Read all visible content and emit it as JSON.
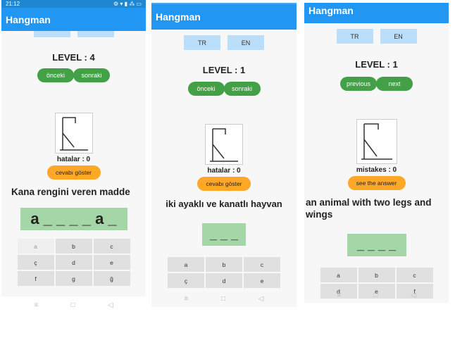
{
  "status_bar": {
    "time": "21:12",
    "icons": "⚙ ▾ ▮ ⁂ ▭"
  },
  "screens": [
    {
      "app_title": "Hangman",
      "level": "LEVEL : 4",
      "prev_label": "önceki",
      "next_label": "sonraki",
      "mistakes": "hatalar : 0",
      "answer_label": "cevabı göster",
      "hint": "Kana rengini veren madde",
      "word": "a _ _ _ _ a _",
      "keys": [
        "a",
        "b",
        "c",
        "ç",
        "d",
        "e",
        "f",
        "g",
        "ğ"
      ]
    },
    {
      "app_title": "Hangman",
      "lang_tr": "TR",
      "lang_en": "EN",
      "level": "LEVEL : 1",
      "prev_label": "önceki",
      "next_label": "sonraki",
      "mistakes": "hatalar : 0",
      "answer_label": "cevabı göster",
      "hint": "iki ayaklı ve kanatlı hayvan",
      "word": "_ _ _",
      "keys": [
        "a",
        "b",
        "c",
        "ç",
        "d",
        "e"
      ]
    },
    {
      "app_title": "Hangman",
      "lang_tr": "TR",
      "lang_en": "EN",
      "level": "LEVEL : 1",
      "prev_label": "previous",
      "next_label": "next",
      "mistakes": "mistakes : 0",
      "answer_label": "see the answer",
      "hint": "an animal with two legs and wings",
      "word": "_ _ _ _",
      "keys": [
        "a",
        "b",
        "c",
        "d",
        "e",
        "f"
      ]
    }
  ],
  "navbar_icons": {
    "recent": "≡",
    "home": "□",
    "back": "◁"
  },
  "colors": {
    "appbar": "#2196f3",
    "lang_button": "#bbdefb",
    "nav_pill": "#43a047",
    "answer_button": "#ffa726",
    "word_box": "#a5d6a7",
    "key": "#e0e0e0"
  }
}
